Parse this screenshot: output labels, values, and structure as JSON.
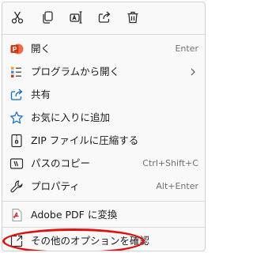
{
  "toolbar": {
    "icons": [
      "cut-icon",
      "copy-icon",
      "rename-icon",
      "share-icon",
      "delete-icon"
    ]
  },
  "menu": {
    "items": [
      {
        "label": "開く",
        "shortcut": "Enter",
        "icon": "powerpoint-icon"
      },
      {
        "label": "プログラムから開く",
        "shortcut": "",
        "icon": "open-with-icon",
        "submenu": true
      },
      {
        "label": "共有",
        "shortcut": "",
        "icon": "share-icon"
      },
      {
        "label": "お気に入りに追加",
        "shortcut": "",
        "icon": "star-icon"
      },
      {
        "label": "ZIP ファイルに圧縮する",
        "shortcut": "",
        "icon": "zip-icon"
      },
      {
        "label": "パスのコピー",
        "shortcut": "Ctrl+Shift+C",
        "icon": "copy-path-icon"
      },
      {
        "label": "プロパティ",
        "shortcut": "Alt+Enter",
        "icon": "wrench-icon"
      },
      {
        "label": "Adobe PDF に変換",
        "shortcut": "",
        "icon": "adobe-pdf-icon"
      },
      {
        "label": "その他のオプションを確認",
        "shortcut": "",
        "icon": "more-options-icon"
      }
    ]
  },
  "colors": {
    "accent": "#0f6cbd",
    "powerpoint": "#c43e1c",
    "pdf": "#d4302a",
    "highlight": "#e01010"
  }
}
